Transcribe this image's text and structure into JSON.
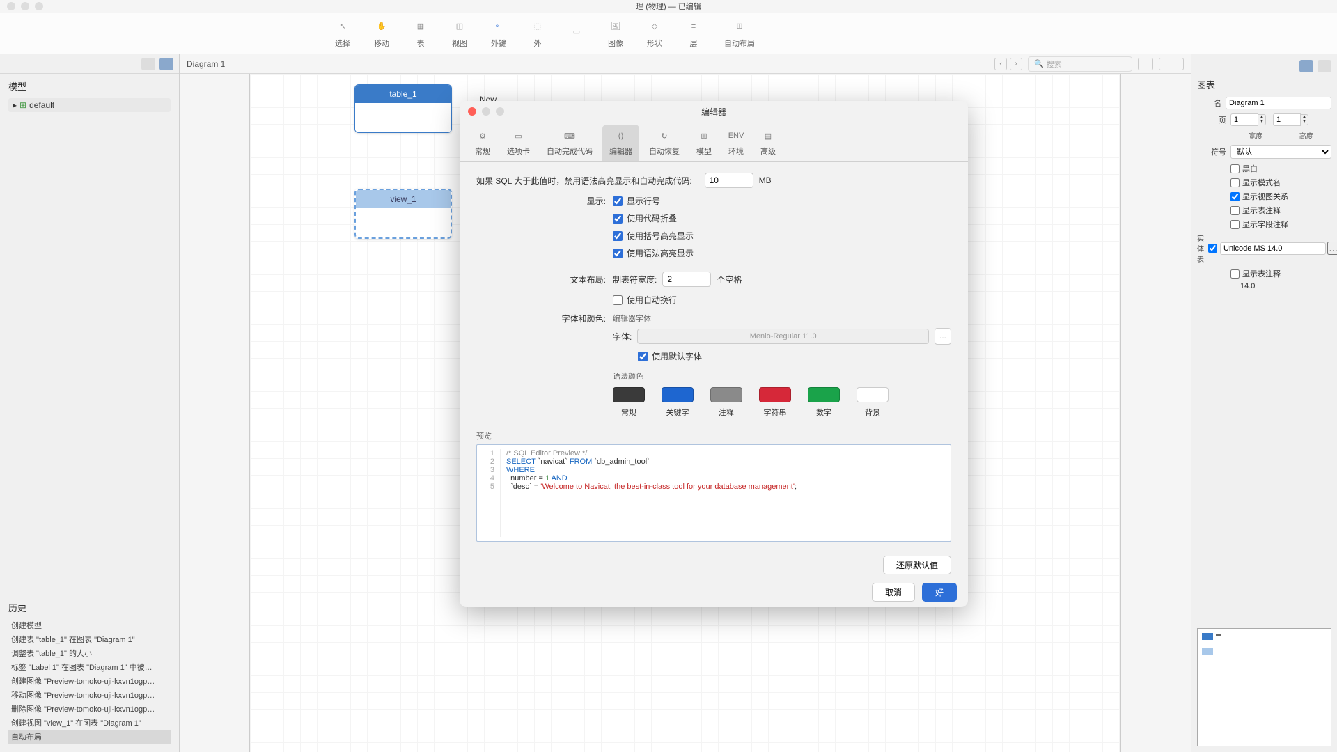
{
  "window": {
    "title": "理 (物理) — 已编辑"
  },
  "toolbar": {
    "items": [
      {
        "label": "选择",
        "icon": "cursor"
      },
      {
        "label": "移动",
        "icon": "hand"
      },
      {
        "label": "表",
        "icon": "table"
      },
      {
        "label": "视图",
        "icon": "view"
      },
      {
        "label": "外键",
        "icon": "fk"
      },
      {
        "label": "外",
        "icon": "layer"
      },
      {
        "label": "",
        "icon": "note"
      },
      {
        "label": "图像",
        "icon": "image"
      },
      {
        "label": "形状",
        "icon": "shape"
      },
      {
        "label": "层",
        "icon": "stack"
      },
      {
        "label": "自动布局",
        "icon": "layout"
      }
    ]
  },
  "left": {
    "model_title": "模型",
    "tree_root": "default",
    "history_title": "历史",
    "history": [
      "创建模型",
      "创建表 \"table_1\" 在图表 \"Diagram 1\"",
      "调整表 \"table_1\" 的大小",
      "标签 \"Label 1\" 在图表 \"Diagram 1\" 中被…",
      "创建图像 \"Preview-tomoko-uji-kxvn1ogp…",
      "移动图像 \"Preview-tomoko-uji-kxvn1ogp…",
      "删除图像 \"Preview-tomoko-uji-kxvn1ogp…",
      "创建视图 \"view_1\" 在图表 \"Diagram 1\"",
      "自动布局"
    ]
  },
  "canvas": {
    "diagram_tab": "Diagram 1",
    "search_placeholder": "搜索",
    "table1": "table_1",
    "view1": "view_1",
    "new_label": "New"
  },
  "right": {
    "section": "图表",
    "name_label": "名",
    "name_value": "Diagram 1",
    "page_label": "页",
    "page_w": "1",
    "page_h": "1",
    "width_label": "宽度",
    "height_label": "高度",
    "symbol_label": "符号",
    "symbol_value": "默认",
    "checks": [
      "黑白",
      "显示模式名",
      "显示视图关系",
      "显示表注释",
      "显示字段注释"
    ],
    "checked_idx": 2,
    "entity_label": "实体表",
    "font_value": "Unicode MS 14.0",
    "show_table_comment": "显示表注释",
    "font_size": "14.0"
  },
  "modal": {
    "title": "编辑器",
    "tabs": [
      "常规",
      "选项卡",
      "自动完成代码",
      "编辑器",
      "自动恢复",
      "模型",
      "环境",
      "高级"
    ],
    "active_tab": 3,
    "threshold_label": "如果 SQL 大于此值时，禁用语法高亮显示和自动完成代码:",
    "threshold_value": "10",
    "threshold_unit": "MB",
    "display_label": "显示:",
    "display_opts": [
      "显示行号",
      "使用代码折叠",
      "使用括号高亮显示",
      "使用语法高亮显示"
    ],
    "layout_label": "文本布局:",
    "tab_width_label": "制表符宽度:",
    "tab_width_value": "2",
    "tab_width_unit": "个空格",
    "wrap_label": "使用自动换行",
    "font_section_label": "字体和颜色:",
    "editor_font_label": "编辑器字体",
    "font_label": "字体:",
    "font_value": "Menlo-Regular 11.0",
    "use_default_font": "使用默认字体",
    "syntax_color_label": "语法颜色",
    "swatches": [
      {
        "label": "常规",
        "color": "#3a3a3a"
      },
      {
        "label": "关键字",
        "color": "#1e66d0"
      },
      {
        "label": "注释",
        "color": "#8a8a8a"
      },
      {
        "label": "字符串",
        "color": "#d62839"
      },
      {
        "label": "数字",
        "color": "#1aa34a"
      },
      {
        "label": "背景",
        "color": "#ffffff"
      }
    ],
    "preview_label": "预览",
    "code_lines": [
      {
        "n": "1",
        "html": "<span class='c-comment'>/* SQL Editor Preview */</span>"
      },
      {
        "n": "2",
        "html": "<span class='c-kw'>SELECT</span> `navicat` <span class='c-kw'>FROM</span> `db_admin_tool`"
      },
      {
        "n": "3",
        "html": "<span class='c-kw'>WHERE</span>"
      },
      {
        "n": "4",
        "html": "  number = <span class='c-num'>1</span> <span class='c-kw'>AND</span>"
      },
      {
        "n": "5",
        "html": "  `desc` = <span class='c-str'>'Welcome to Navicat, the best-in-class tool for your database management'</span>;"
      }
    ],
    "reset_btn": "还原默认值",
    "cancel_btn": "取消",
    "ok_btn": "好"
  }
}
